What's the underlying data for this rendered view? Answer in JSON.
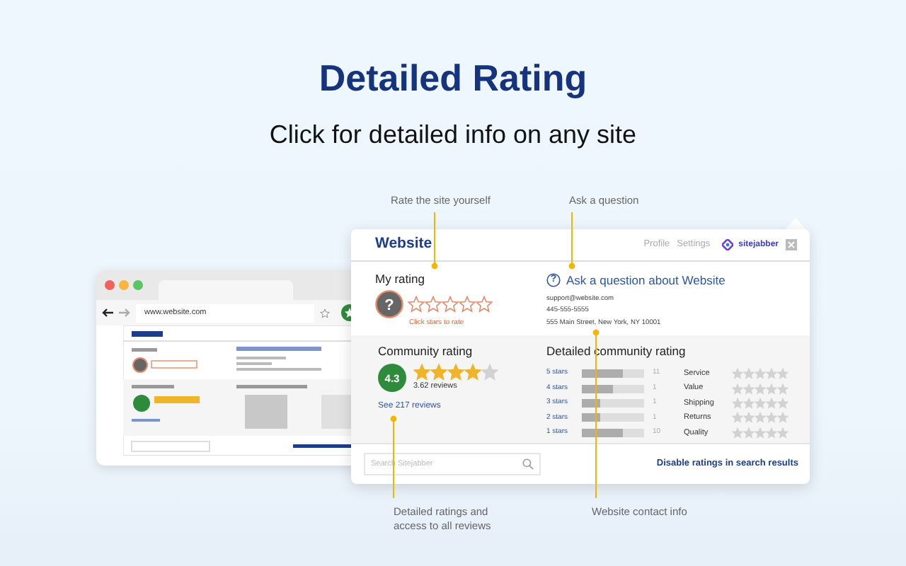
{
  "title": "Detailed Rating",
  "subtitle": "Click for detailed info on any site",
  "callouts_top": [
    "Rate the site yourself",
    "Ask a question"
  ],
  "callouts_bottom": [
    "Detailed ratings and access to all reviews",
    "Website contact info"
  ],
  "browser": {
    "url": "www.website.com"
  },
  "popup": {
    "title": "Website",
    "links": [
      "Profile",
      "Settings"
    ],
    "brand": "sitejabber",
    "my_rating": {
      "heading": "My rating",
      "icon": "?",
      "stars": 0,
      "hint": "Click stars to rate"
    },
    "question": {
      "icon": "?",
      "link": "Ask a question about Website",
      "contact": [
        "support@website.com",
        "445-555-5555",
        "555 Main Street, New York, NY 10001"
      ]
    },
    "community": {
      "heading": "Community rating",
      "score": "4.3",
      "stars": 4,
      "reviews": "3.62 reviews",
      "link": "See 217 reviews"
    },
    "detailed": {
      "heading": "Detailed community rating",
      "distribution": [
        {
          "label": "5 stars",
          "level": 0.67,
          "count": "11"
        },
        {
          "label": "4 stars",
          "level": 0.5,
          "count": "1"
        },
        {
          "label": "3 stars",
          "level": 0.3,
          "count": "1"
        },
        {
          "label": "2 stars",
          "level": 0.3,
          "count": "1"
        },
        {
          "label": "1 stars",
          "level": 0.67,
          "count": "10"
        }
      ],
      "categories": [
        {
          "name": "Service",
          "stars": 0
        },
        {
          "name": "Value",
          "stars": 0
        },
        {
          "name": "Shipping",
          "stars": 0
        },
        {
          "name": "Returns",
          "stars": 0
        },
        {
          "name": "Quality",
          "stars": 0
        }
      ]
    },
    "search": {
      "placeholder": "Search Sitejabber"
    },
    "footer_link": "Disable ratings in search results"
  }
}
